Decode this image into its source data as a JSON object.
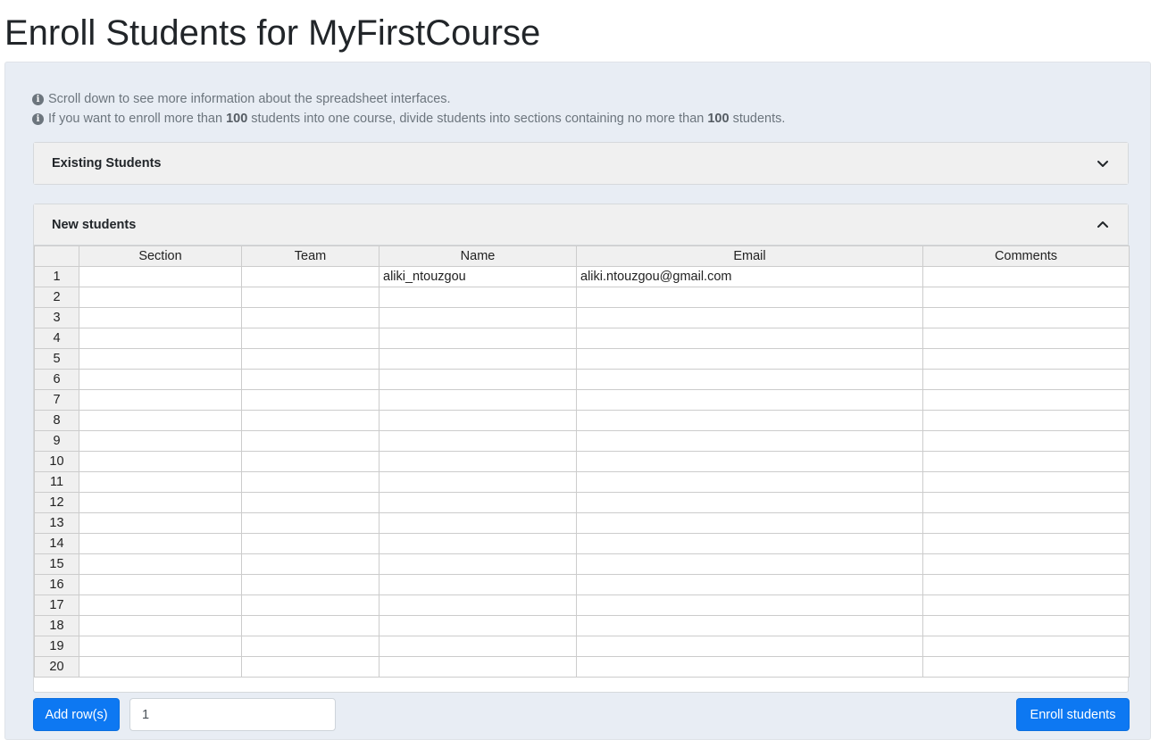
{
  "page": {
    "title": "Enroll Students for MyFirstCourse"
  },
  "info": {
    "line1": "Scroll down to see more information about the spreadsheet interfaces.",
    "line2_parts": [
      "If you want to enroll more than ",
      "100",
      " students into one course, divide students into sections containing no more than ",
      "100",
      " students."
    ],
    "icon": "info-circle-icon"
  },
  "existing": {
    "title": "Existing Students",
    "expanded": false
  },
  "new_students": {
    "title": "New students",
    "expanded": true,
    "columns": [
      "Section",
      "Team",
      "Name",
      "Email",
      "Comments"
    ],
    "rows": [
      {
        "num": "1",
        "cells": [
          "",
          "",
          "aliki_ntouzgou",
          "aliki.ntouzgou@gmail.com",
          ""
        ]
      },
      {
        "num": "2",
        "cells": [
          "",
          "",
          "",
          "",
          ""
        ]
      },
      {
        "num": "3",
        "cells": [
          "",
          "",
          "",
          "",
          ""
        ]
      },
      {
        "num": "4",
        "cells": [
          "",
          "",
          "",
          "",
          ""
        ]
      },
      {
        "num": "5",
        "cells": [
          "",
          "",
          "",
          "",
          ""
        ]
      },
      {
        "num": "6",
        "cells": [
          "",
          "",
          "",
          "",
          ""
        ]
      },
      {
        "num": "7",
        "cells": [
          "",
          "",
          "",
          "",
          ""
        ]
      },
      {
        "num": "8",
        "cells": [
          "",
          "",
          "",
          "",
          ""
        ]
      },
      {
        "num": "9",
        "cells": [
          "",
          "",
          "",
          "",
          ""
        ]
      },
      {
        "num": "10",
        "cells": [
          "",
          "",
          "",
          "",
          ""
        ]
      },
      {
        "num": "11",
        "cells": [
          "",
          "",
          "",
          "",
          ""
        ]
      },
      {
        "num": "12",
        "cells": [
          "",
          "",
          "",
          "",
          ""
        ]
      },
      {
        "num": "13",
        "cells": [
          "",
          "",
          "",
          "",
          ""
        ]
      },
      {
        "num": "14",
        "cells": [
          "",
          "",
          "",
          "",
          ""
        ]
      },
      {
        "num": "15",
        "cells": [
          "",
          "",
          "",
          "",
          ""
        ]
      },
      {
        "num": "16",
        "cells": [
          "",
          "",
          "",
          "",
          ""
        ]
      },
      {
        "num": "17",
        "cells": [
          "",
          "",
          "",
          "",
          ""
        ]
      },
      {
        "num": "18",
        "cells": [
          "",
          "",
          "",
          "",
          ""
        ]
      },
      {
        "num": "19",
        "cells": [
          "",
          "",
          "",
          "",
          ""
        ]
      },
      {
        "num": "20",
        "cells": [
          "",
          "",
          "",
          "",
          ""
        ]
      }
    ]
  },
  "actions": {
    "add_rows_label": "Add row(s)",
    "rows_count_value": "1",
    "enroll_label": "Enroll students"
  },
  "colors": {
    "primary": "#0d78f2",
    "panel_bg": "#e8edf4",
    "header_bg": "#f0f0f0"
  }
}
